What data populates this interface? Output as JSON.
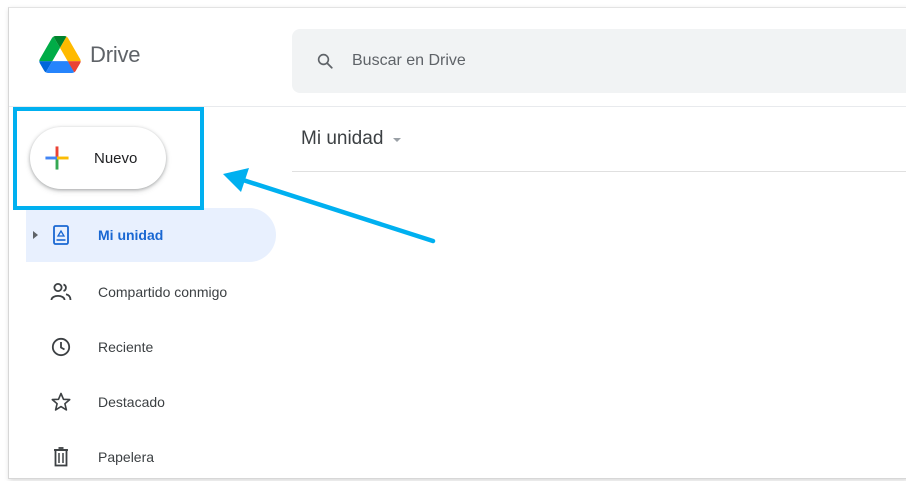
{
  "app": {
    "name": "Drive",
    "brand_colors": {
      "green": "#0F9D58",
      "yellow": "#F4B400",
      "blue": "#4285F4"
    }
  },
  "search": {
    "placeholder": "Buscar en Drive",
    "icon": "search-icon"
  },
  "new_button": {
    "label": "Nuevo",
    "icon": "plus-multicolor-icon"
  },
  "main": {
    "title": "Mi unidad",
    "dropdown_icon": "caret-down-icon"
  },
  "sidebar": {
    "items": [
      {
        "label": "Mi unidad",
        "icon": "my-drive-icon",
        "active": true,
        "expandable": true
      },
      {
        "label": "Compartido conmigo",
        "icon": "shared-people-icon",
        "active": false
      },
      {
        "label": "Reciente",
        "icon": "clock-icon",
        "active": false
      },
      {
        "label": "Destacado",
        "icon": "star-icon",
        "active": false
      },
      {
        "label": "Papelera",
        "icon": "trash-icon",
        "active": false
      }
    ]
  },
  "annotation": {
    "highlight_color": "#00b0f0",
    "arrow_color": "#00b0f0"
  }
}
